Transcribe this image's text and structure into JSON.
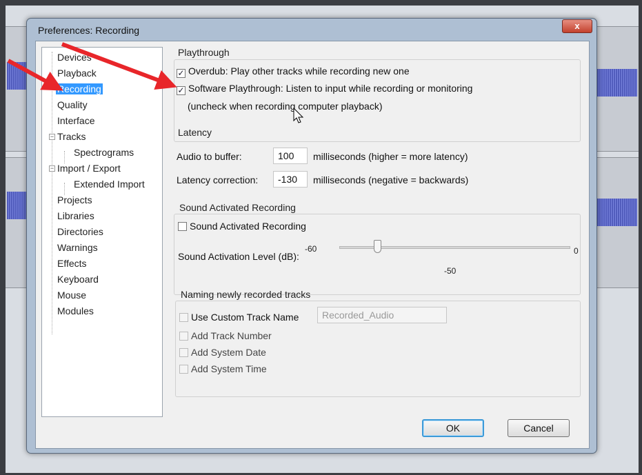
{
  "window": {
    "title": "Preferences: Recording",
    "close_label": "x"
  },
  "sidebar": {
    "items": [
      {
        "label": "Devices"
      },
      {
        "label": "Playback"
      },
      {
        "label": "Recording"
      },
      {
        "label": "Quality"
      },
      {
        "label": "Interface"
      },
      {
        "label": "Tracks"
      },
      {
        "label": "Spectrograms"
      },
      {
        "label": "Import / Export"
      },
      {
        "label": "Extended Import"
      },
      {
        "label": "Projects"
      },
      {
        "label": "Libraries"
      },
      {
        "label": "Directories"
      },
      {
        "label": "Warnings"
      },
      {
        "label": "Effects"
      },
      {
        "label": "Keyboard"
      },
      {
        "label": "Mouse"
      },
      {
        "label": "Modules"
      }
    ],
    "selected": "Recording"
  },
  "playthrough": {
    "title": "Playthrough",
    "overdub_label": "Overdub: Play other tracks while recording new one",
    "overdub_checked": true,
    "software_label": "Software Playthrough: Listen to input while recording or monitoring",
    "software_checked": true,
    "software_note": "(uncheck when recording computer playback)"
  },
  "latency": {
    "title": "Latency",
    "buffer_label": "Audio to buffer:",
    "buffer_value": "100",
    "buffer_unit": "milliseconds (higher = more latency)",
    "correction_label": "Latency correction:",
    "correction_value": "-130",
    "correction_unit": "milliseconds (negative = backwards)"
  },
  "sound_activated": {
    "title": "Sound Activated Recording",
    "checkbox_label": "Sound Activated Recording",
    "checked": false,
    "level_label": "Sound Activation Level (dB):",
    "min_label": "-60",
    "max_label": "0",
    "value_label": "-50",
    "level_fraction": 0.167
  },
  "naming": {
    "title": "Naming newly recorded tracks",
    "custom_label": "Use Custom Track Name",
    "custom_value": "Recorded_Audio",
    "track_number_label": "Add Track Number",
    "system_date_label": "Add System Date",
    "system_time_label": "Add System Time"
  },
  "buttons": {
    "ok": "OK",
    "cancel": "Cancel"
  },
  "check_mark": "✓",
  "colors": {
    "selection": "#3399ff",
    "arrow": "#e8262a",
    "default_button_border": "#3c9ad8"
  }
}
